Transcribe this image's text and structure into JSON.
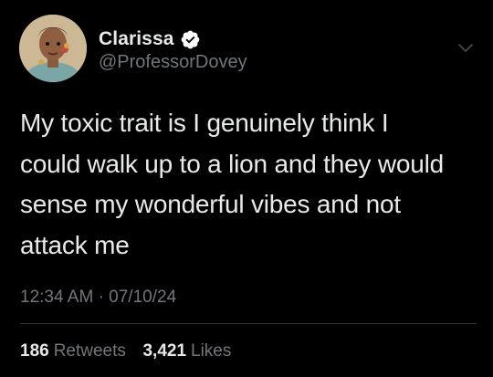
{
  "author": {
    "display_name": "Clarissa",
    "handle": "@ProfessorDovey",
    "verified": true,
    "avatar_icon": "profile-photo"
  },
  "tweet": {
    "text": "My toxic trait is I genuinely think I\ncould walk up to a lion and they would\nsense my wonderful vibes and not\nattack me",
    "time": "12:34 AM",
    "separator": "·",
    "date": "07/10/24"
  },
  "stats": {
    "retweets_count": "186",
    "retweets_label": "Retweets",
    "likes_count": "3,421",
    "likes_label": "Likes"
  },
  "colors": {
    "background": "#000000",
    "primary_text": "#e7e9ea",
    "secondary_text": "#71767b",
    "verified_badge": "#ffffff",
    "divider": "#2f3336"
  },
  "icons": {
    "verified": "verified-badge-icon",
    "menu": "chevron-down-icon"
  }
}
